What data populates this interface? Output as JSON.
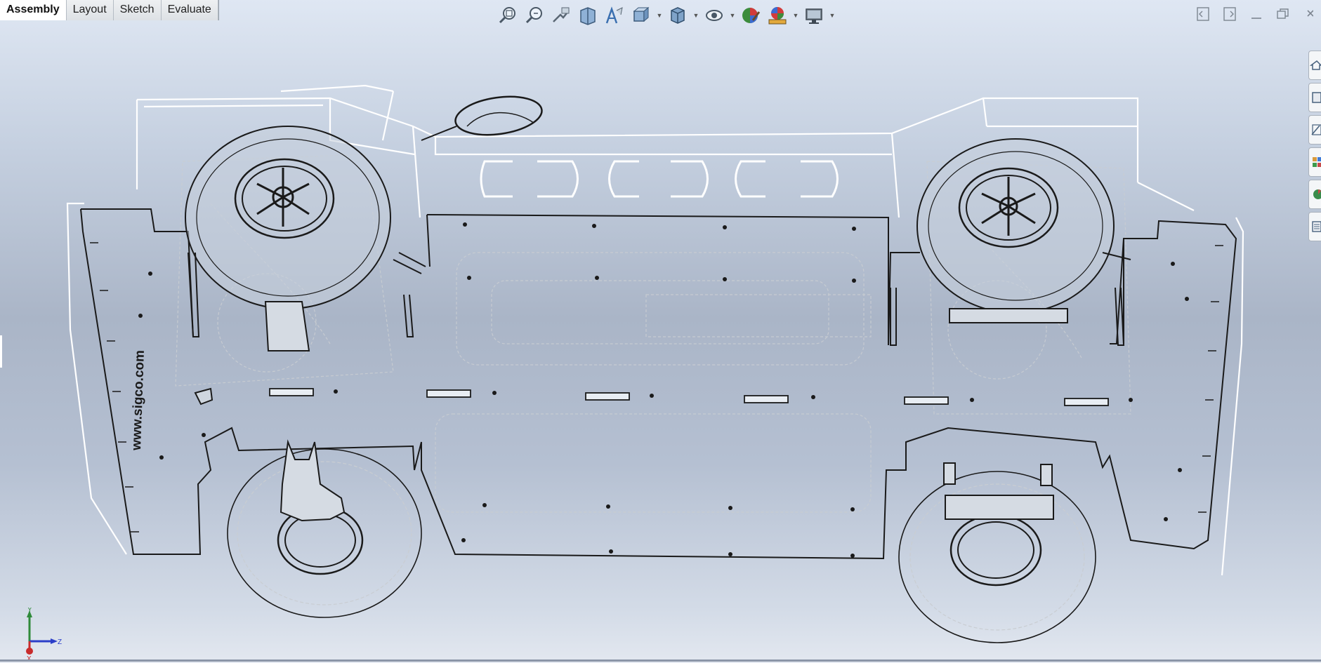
{
  "command_manager": {
    "tabs": [
      {
        "label": "Assembly",
        "active": true
      },
      {
        "label": "Layout",
        "active": false
      },
      {
        "label": "Sketch",
        "active": false
      },
      {
        "label": "Evaluate",
        "active": false
      }
    ]
  },
  "heads_up_toolbar": {
    "buttons": [
      {
        "icon": "zoom-to-fit-icon"
      },
      {
        "icon": "zoom-to-area-icon"
      },
      {
        "icon": "previous-view-icon"
      },
      {
        "icon": "section-view-icon"
      },
      {
        "icon": "dynamic-annotation-icon"
      },
      {
        "icon": "view-orientation-icon"
      },
      {
        "icon": "display-style-icon"
      },
      {
        "icon": "hide-show-items-icon"
      },
      {
        "icon": "edit-appearance-icon"
      },
      {
        "icon": "apply-scene-icon"
      },
      {
        "icon": "view-settings-icon"
      }
    ]
  },
  "window_controls": [
    "tile-left-icon",
    "tile-right-icon",
    "minimize-icon",
    "restore-icon",
    "close-icon"
  ],
  "task_pane": [
    "home-icon",
    "design-library-icon",
    "file-explorer-icon",
    "view-palette-icon",
    "appearances-icon",
    "custom-properties-icon"
  ],
  "model": {
    "engraving": "www.sigco.com"
  },
  "triad": {
    "x_label": "X",
    "y_label": "Y",
    "z_label": "Z"
  },
  "colors": {
    "active_tab": "#ffffff",
    "viewport_top": "#dfe7f3",
    "viewport_mid": "#aab5c7",
    "edge_dark": "#1a1a1a",
    "edge_light": "#ffffff"
  }
}
